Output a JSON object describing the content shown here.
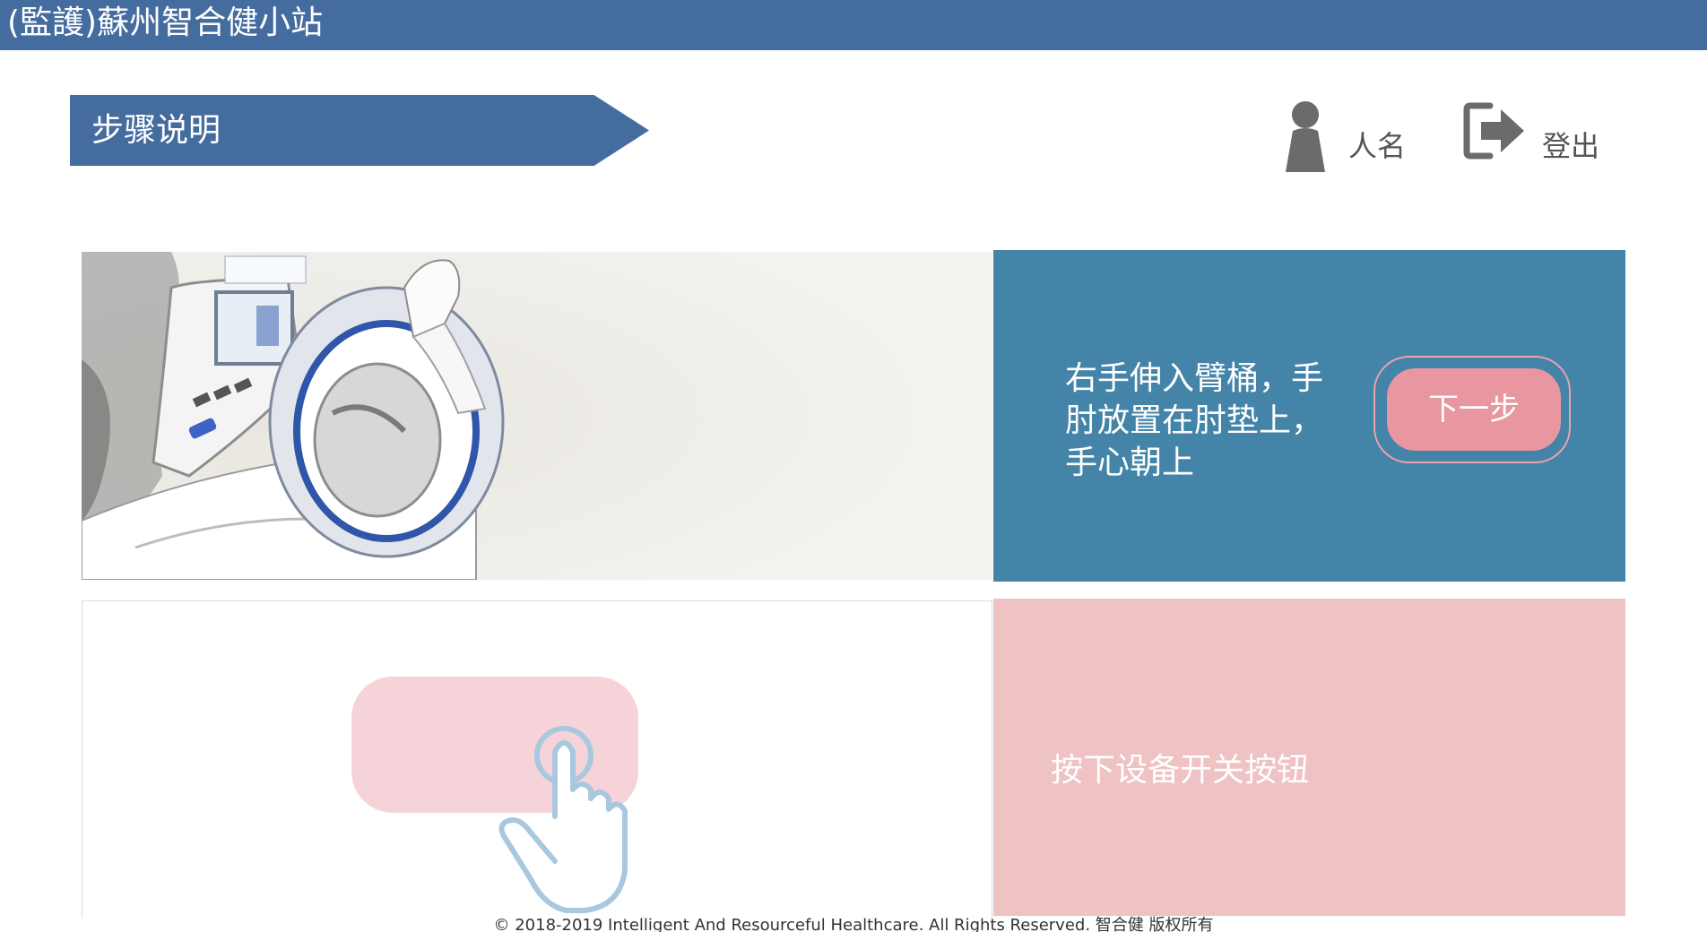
{
  "header": {
    "title": "(監護)蘇州智合健小站",
    "background_color": "#456c9f"
  },
  "step_banner": {
    "label": "步骤说明"
  },
  "user": {
    "name": "人名",
    "icon": "person-icon"
  },
  "logout": {
    "label": "登出",
    "icon": "logout-icon"
  },
  "steps": {
    "step_1": {
      "instruction": "右手伸入臂桶，手肘放置在肘垫上，手心朝上",
      "next_label": "下一步",
      "panel_color": "#4384a8",
      "button_color": "#e8969f",
      "illustration": "blood-pressure-monitor-illustration"
    },
    "step_2": {
      "instruction": "按下设备开关按钮",
      "panel_color": "#efc2c3",
      "illustration": "press-button-hand-icon"
    }
  },
  "footer": {
    "copyright": "© 2018-2019 Intelligent And Resourceful Healthcare. All Rights Reserved. 智合健 版权所有"
  }
}
